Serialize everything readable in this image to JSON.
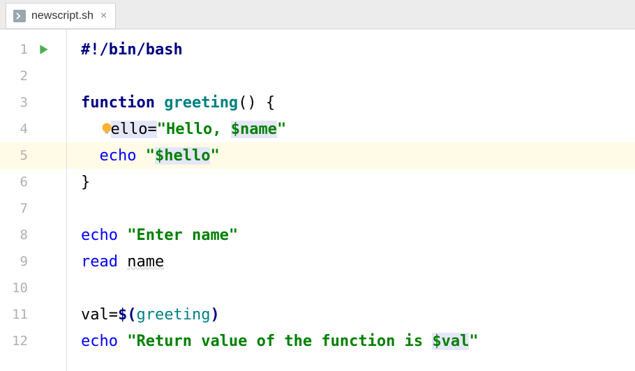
{
  "tab": {
    "filename": "newscript.sh"
  },
  "gutter": {
    "lines": [
      "1",
      "2",
      "3",
      "4",
      "5",
      "6",
      "7",
      "8",
      "9",
      "10",
      "11",
      "12"
    ]
  },
  "code": {
    "l1_shebang": "#!/bin/bash",
    "l3_function": "function",
    "l3_name": "greeting",
    "l3_paren_brace": "() {",
    "l4_hello_partial": "ello=",
    "l4_str_open": "\"Hello, ",
    "l4_var_name": "$name",
    "l4_str_close": "\"",
    "l5_echo": "echo",
    "l5_str_open": "\"",
    "l5_var_hello": "$hello",
    "l5_str_close": "\"",
    "l6_brace": "}",
    "l8_echo": "echo",
    "l8_str": "\"Enter name\"",
    "l9_read": "read",
    "l9_name": "name",
    "l11_val_eq": "val=",
    "l11_dollar_open": "$(",
    "l11_call": "greeting",
    "l11_close": ")",
    "l12_echo": "echo",
    "l12_str_open": "\"Return value of the function is ",
    "l12_var_val": "$val",
    "l12_str_close": "\""
  }
}
